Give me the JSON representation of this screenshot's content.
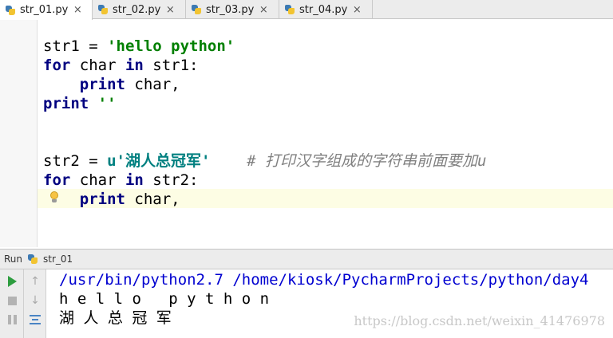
{
  "tabs": [
    {
      "label": "str_01.py",
      "close": "×",
      "active": true
    },
    {
      "label": "str_02.py",
      "close": "×",
      "active": false
    },
    {
      "label": "str_03.py",
      "close": "×",
      "active": false
    },
    {
      "label": "str_04.py",
      "close": "×",
      "active": false
    }
  ],
  "editor": {
    "lines": {
      "l1": {
        "var": "str1 = ",
        "str": "'hello python'"
      },
      "l2": {
        "kw1": "for",
        "mid": " char ",
        "kw2": "in",
        "rest": " str1:"
      },
      "l3": {
        "indent": "    ",
        "kw": "print",
        "rest": " char,"
      },
      "l4": {
        "kw": "print",
        "str": " ''"
      },
      "l5": {
        "var": "str2 = ",
        "str": "u'湖人总冠军'",
        "gap": "    ",
        "comment": "# 打印汉字组成的字符串前面要加u"
      },
      "l6": {
        "kw1": "for",
        "mid": " char ",
        "kw2": "in",
        "rest": " str2:"
      },
      "l7": {
        "indent": "    ",
        "kw": "print",
        "rest": " char,"
      }
    }
  },
  "run": {
    "label": "Run",
    "config": "str_01"
  },
  "console": {
    "command": "/usr/bin/python2.7 /home/kiosk/PycharmProjects/python/day4",
    "output1": "h e l l o   p y t h o n",
    "output2": "湖 人 总 冠 军"
  },
  "watermark": "https://blog.csdn.net/weixin_41476978",
  "colors": {
    "keyword": "#000080",
    "string": "#008000",
    "unicode_string": "#008080",
    "comment": "#808080",
    "caret_row": "#fdfde4",
    "console_command": "#0000d0"
  }
}
